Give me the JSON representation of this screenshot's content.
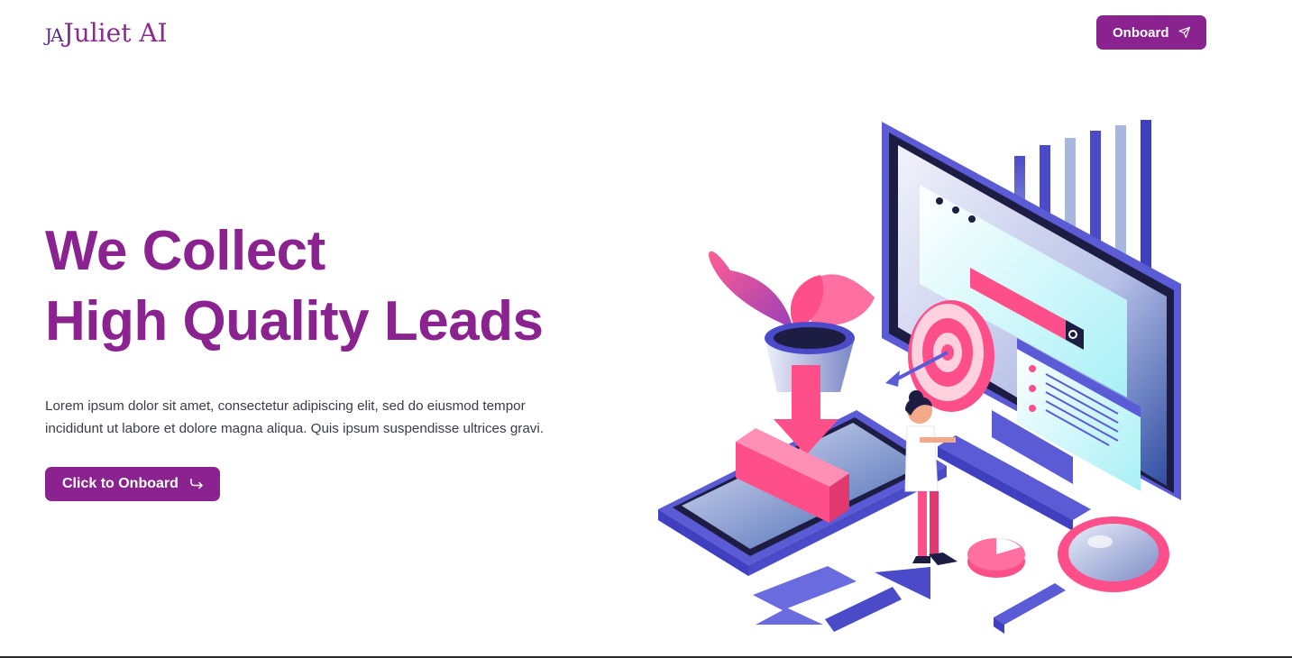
{
  "header": {
    "logo_mark": "JA",
    "logo_text": "Juliet AI",
    "onboard_label": "Onboard",
    "onboard_icon": "send-icon"
  },
  "hero": {
    "title_line1": "We Collect",
    "title_line2": "High Quality Leads",
    "description_line1": "Lorem ipsum dolor sit amet, consectetur adipiscing elit, sed do eiusmod tempor",
    "description_line2": "incididunt ut labore et dolore magna aliqua. Quis ipsum suspendisse ultrices gravi.",
    "cta_label": "Click to Onboard",
    "cta_icon": "arrow-return-icon"
  },
  "colors": {
    "brand": "#8a2390",
    "accent_pink": "#ff4f8b",
    "accent_blue": "#5b5bd6",
    "text": "#3b3b4a"
  }
}
